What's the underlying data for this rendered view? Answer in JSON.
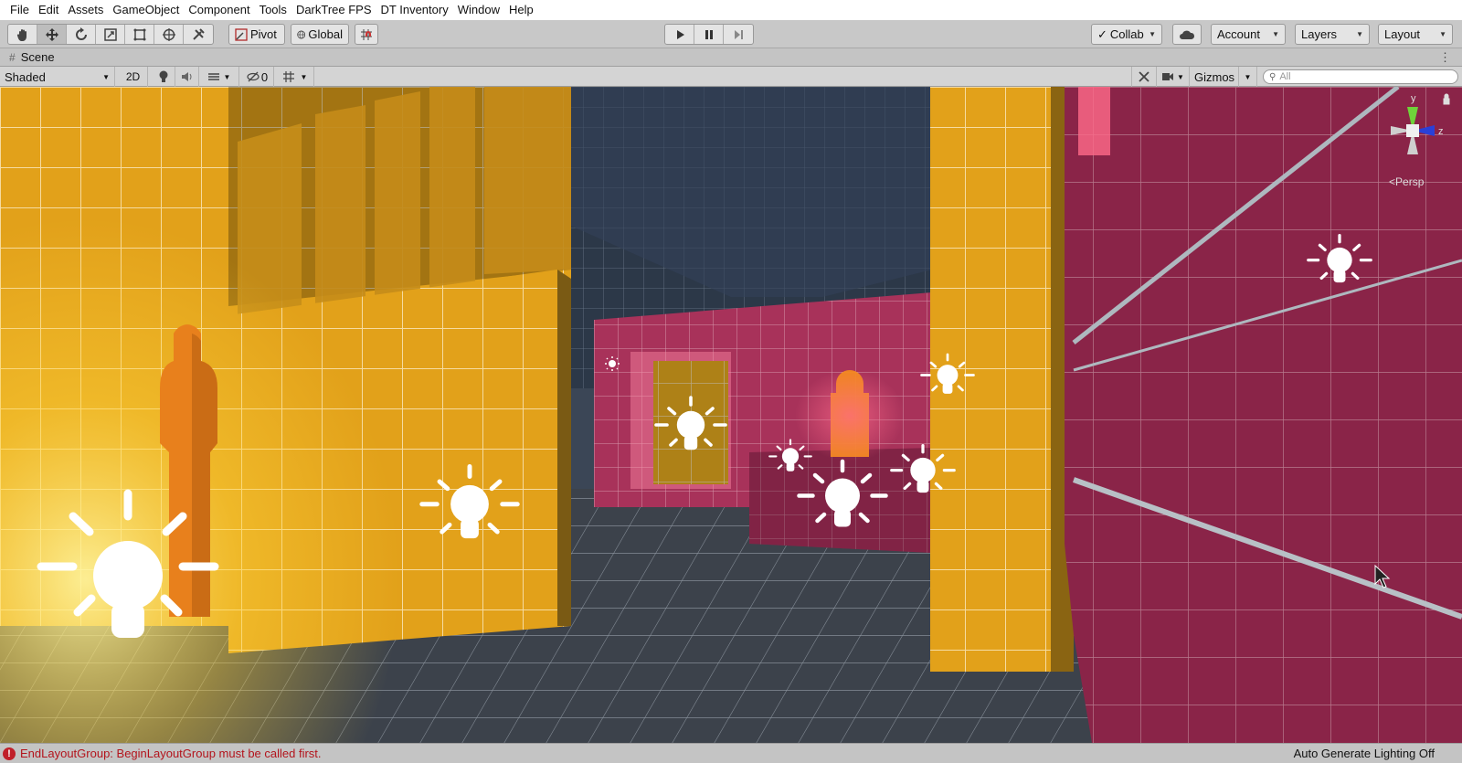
{
  "menu": [
    "File",
    "Edit",
    "Assets",
    "GameObject",
    "Component",
    "Tools",
    "DarkTree FPS",
    "DT Inventory",
    "Window",
    "Help"
  ],
  "toolbar": {
    "tools": [
      "hand-tool-icon",
      "move-tool-icon",
      "rotate-tool-icon",
      "scale-tool-icon",
      "rect-tool-icon",
      "transform-tool-icon",
      "custom-tool-icon"
    ],
    "pivot_label": "Pivot",
    "global_label": "Global",
    "collab_label": "Collab",
    "account_label": "Account",
    "layers_label": "Layers",
    "layout_label": "Layout"
  },
  "scene_tab": {
    "title": "Scene"
  },
  "scene_toolbar": {
    "shading_mode": "Shaded",
    "mode_2d": "2D",
    "hidden_count": "0",
    "gizmos_label": "Gizmos",
    "search_placeholder": "All"
  },
  "viewport": {
    "projection_label": "Persp",
    "axis_labels": {
      "y": "y",
      "z": "z"
    }
  },
  "status": {
    "error_message": "EndLayoutGroup: BeginLayoutGroup must be called first.",
    "lighting_status": "Auto Generate Lighting Off"
  },
  "colors": {
    "wall_yellow": "#e9a913",
    "wall_magenta": "#8c2447",
    "floor": "#3c4048",
    "ceiling": "#2f3a4a",
    "error_red": "#c0202a"
  }
}
